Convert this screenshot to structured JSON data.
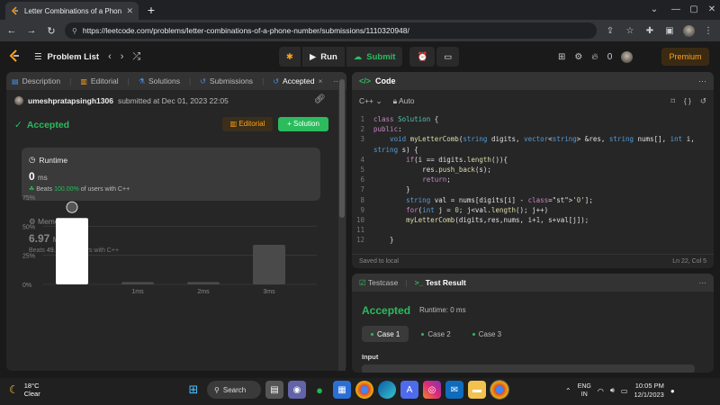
{
  "browser": {
    "tab_title": "Letter Combinations of a Phone",
    "url": "https://leetcode.com/problems/letter-combinations-of-a-phone-number/submissions/1110320948/"
  },
  "nav": {
    "problem_list": "Problem List",
    "run": "Run",
    "submit": "Submit",
    "streak": "0",
    "premium": "Premium"
  },
  "left_tabs": [
    "Description",
    "Editorial",
    "Solutions",
    "Submissions",
    "Accepted"
  ],
  "submission": {
    "user": "umeshpratapsingh1306",
    "submitted_text": "submitted at Dec 01, 2023 22:05",
    "status": "Accepted",
    "editorial_btn": "Editorial",
    "solution_btn": "+ Solution"
  },
  "runtime": {
    "label": "Runtime",
    "value": "0",
    "unit": "ms",
    "beats_pre": "Beats",
    "beats_pct": "100.00%",
    "beats_post": "of users with C++"
  },
  "memory": {
    "label": "Memory",
    "value": "6.97",
    "unit": "MB",
    "beats_pre": "Beats",
    "beats_pct": "49.60%",
    "beats_post": "of users with C++"
  },
  "chart_data": {
    "type": "bar",
    "categories": [
      "0ms",
      "1ms",
      "2ms",
      "3ms"
    ],
    "visible_tick_labels": [
      "",
      "1ms",
      "2ms",
      "3ms"
    ],
    "values": [
      57,
      2,
      2,
      34
    ],
    "highlight_index": 0,
    "y_ticks": [
      "75%",
      "50%",
      "25%",
      "0%"
    ],
    "ylim": [
      0,
      75
    ],
    "colors": {
      "highlight": "#ffffff",
      "normal": "#4a4a4a",
      "grid": "#3a3a3a"
    }
  },
  "code": {
    "title": "Code",
    "language": "C++",
    "mode": "Auto",
    "saved": "Saved to local",
    "cursor": "Ln 22, Col 5",
    "lines": [
      {
        "n": "1",
        "t": "class Solution {"
      },
      {
        "n": "2",
        "t": "public:"
      },
      {
        "n": "3",
        "t": "    void myLetterComb(string digits, vector<string> &res, string nums[], int i,"
      },
      {
        "n": "",
        "t": "string s) {"
      },
      {
        "n": "4",
        "t": "        if(i == digits.length()){"
      },
      {
        "n": "5",
        "t": "            res.push_back(s);"
      },
      {
        "n": "6",
        "t": "            return;"
      },
      {
        "n": "7",
        "t": "        }"
      },
      {
        "n": "8",
        "t": "        string val = nums[digits[i] - '0'];"
      },
      {
        "n": "9",
        "t": "        for(int j = 0; j<val.length(); j++)"
      },
      {
        "n": "10",
        "t": "        myLetterComb(digits,res,nums, i+1, s+val[j]);"
      },
      {
        "n": "11",
        "t": ""
      },
      {
        "n": "12",
        "t": "    }"
      }
    ]
  },
  "test": {
    "testcase_tab": "Testcase",
    "result_tab": "Test Result",
    "status": "Accepted",
    "runtime": "Runtime: 0 ms",
    "cases": [
      "Case 1",
      "Case 2",
      "Case 3"
    ],
    "input_label": "Input"
  },
  "taskbar": {
    "temp": "18°C",
    "weather": "Clear",
    "search": "Search",
    "lang1": "ENG",
    "lang2": "IN",
    "time": "10:05 PM",
    "date": "12/1/2023"
  }
}
